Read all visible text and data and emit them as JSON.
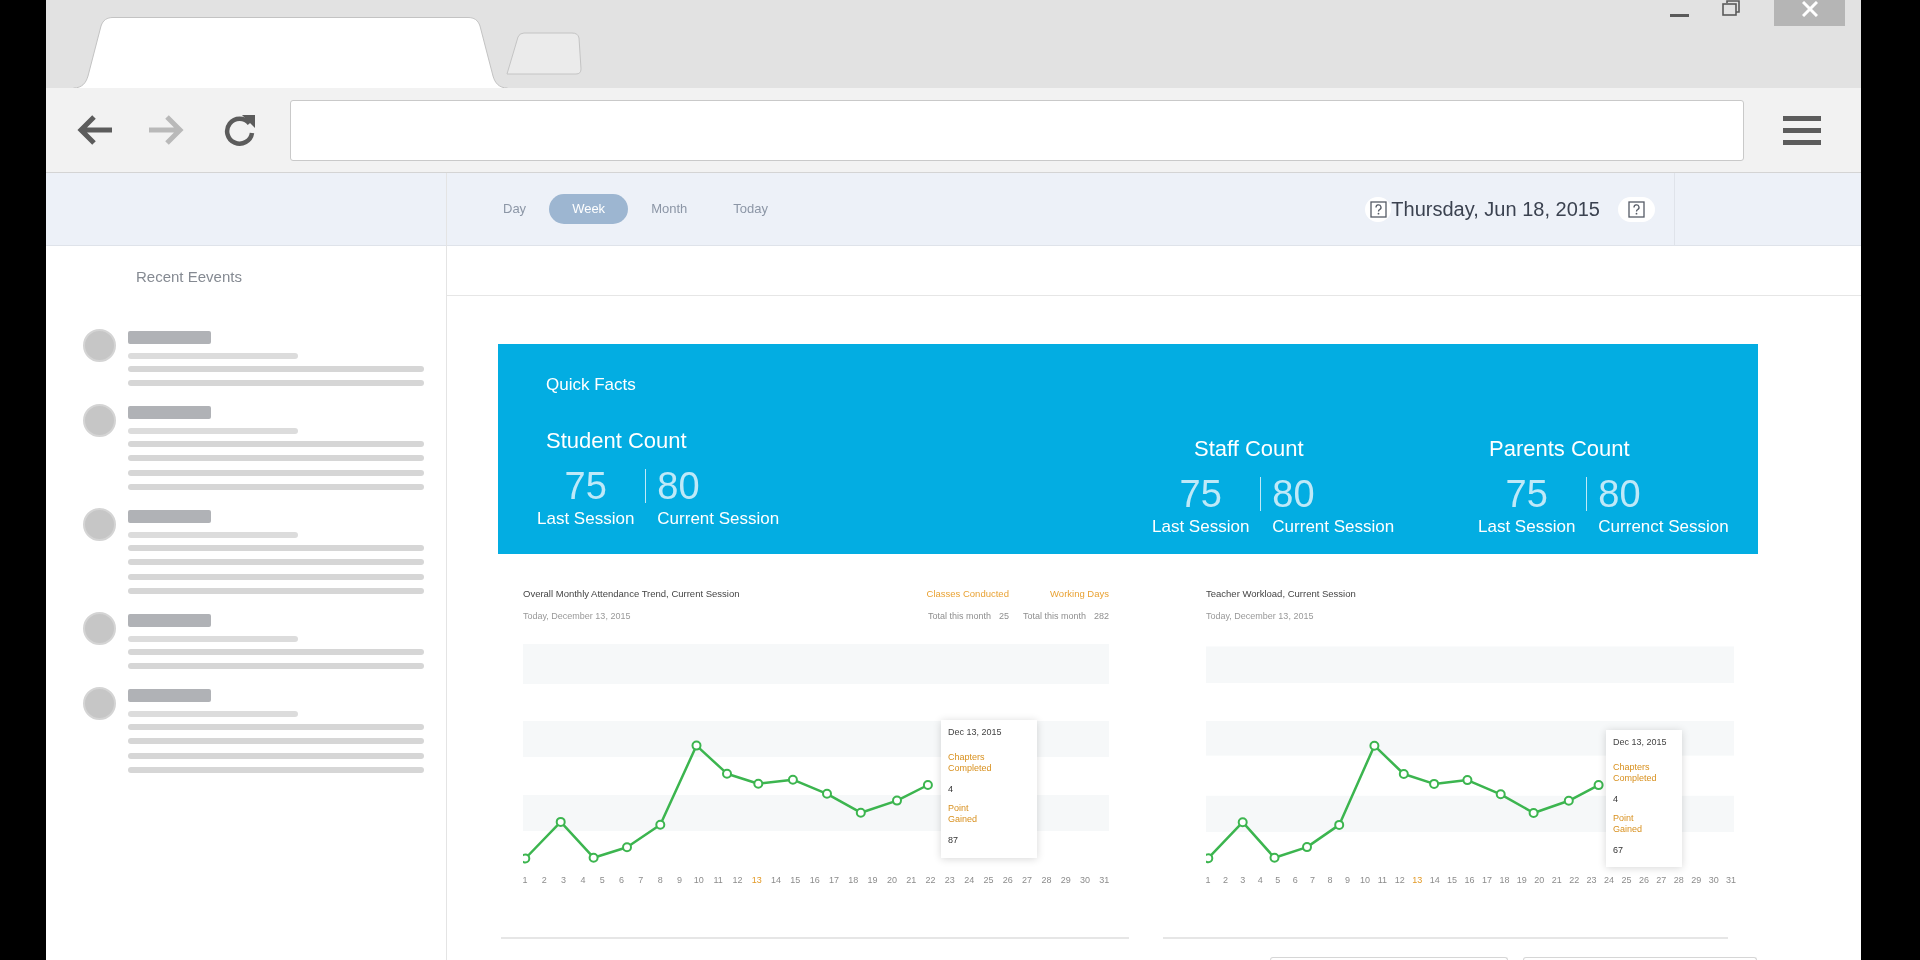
{
  "browser": {
    "buttons": [
      {
        "kind": "back",
        "disabled": false
      },
      {
        "kind": "forward",
        "disabled": true
      },
      {
        "kind": "reload",
        "disabled": false
      }
    ]
  },
  "view_tabs": [
    {
      "label": "Day",
      "selected": false
    },
    {
      "label": "Week",
      "selected": true
    },
    {
      "label": "Month",
      "selected": false
    },
    {
      "label": "Today",
      "selected": false
    }
  ],
  "date_display": "Thursday, Jun 18, 2015",
  "sidebar": {
    "title": "Recent Eevents"
  },
  "quick_facts": {
    "title": "Quick Facts",
    "groups": [
      {
        "title": "Student Count",
        "last_value": "75",
        "current_value": "80",
        "last_label": "Last Session",
        "current_label": "Current Session"
      },
      {
        "title": "Staff Count",
        "last_value": "75",
        "current_value": "80",
        "last_label": "Last Session",
        "current_label": "Current Session"
      },
      {
        "title": "Parents Count",
        "last_value": "75",
        "current_value": "80",
        "last_label": "Last Session",
        "current_label": "Currenct Session"
      }
    ]
  },
  "charts": [
    {
      "title": "Overall Monthly Attendance Trend, Current Session",
      "subtitle": "Today, December 13, 2015",
      "legend": [
        {
          "label": "Classes Conducted",
          "detail": "Total this month",
          "value": "25"
        },
        {
          "label": "Working Days",
          "detail": "Total this month",
          "value": "282"
        }
      ],
      "x_labels": [
        {
          "label": "1",
          "highlighted": false
        },
        {
          "label": "2",
          "highlighted": false
        },
        {
          "label": "3",
          "highlighted": false
        },
        {
          "label": "4",
          "highlighted": false
        },
        {
          "label": "5",
          "highlighted": false
        },
        {
          "label": "6",
          "highlighted": false
        },
        {
          "label": "7",
          "highlighted": false
        },
        {
          "label": "8",
          "highlighted": false
        },
        {
          "label": "9",
          "highlighted": false
        },
        {
          "label": "10",
          "highlighted": false
        },
        {
          "label": "11",
          "highlighted": false
        },
        {
          "label": "12",
          "highlighted": false
        },
        {
          "label": "13",
          "highlighted": true
        },
        {
          "label": "14",
          "highlighted": false
        },
        {
          "label": "15",
          "highlighted": false
        },
        {
          "label": "16",
          "highlighted": false
        },
        {
          "label": "17",
          "highlighted": false
        },
        {
          "label": "18",
          "highlighted": false
        },
        {
          "label": "19",
          "highlighted": false
        },
        {
          "label": "20",
          "highlighted": false
        },
        {
          "label": "21",
          "highlighted": false
        },
        {
          "label": "22",
          "highlighted": false
        },
        {
          "label": "23",
          "highlighted": false
        },
        {
          "label": "24",
          "highlighted": false
        },
        {
          "label": "25",
          "highlighted": false
        },
        {
          "label": "26",
          "highlighted": false
        },
        {
          "label": "27",
          "highlighted": false
        },
        {
          "label": "28",
          "highlighted": false
        },
        {
          "label": "29",
          "highlighted": false
        },
        {
          "label": "30",
          "highlighted": false
        },
        {
          "label": "31",
          "highlighted": false
        }
      ],
      "tooltip": {
        "date": "Dec 13, 2015",
        "rows": [
          {
            "label": "Chapters Completed",
            "value": "4"
          },
          {
            "label": "Point Gained",
            "value": "87"
          }
        ]
      }
    },
    {
      "title": "Teacher Workload, Current Session",
      "subtitle": "Today, December 13, 2015",
      "x_labels": [
        {
          "label": "1",
          "highlighted": false
        },
        {
          "label": "2",
          "highlighted": false
        },
        {
          "label": "3",
          "highlighted": false
        },
        {
          "label": "4",
          "highlighted": false
        },
        {
          "label": "5",
          "highlighted": false
        },
        {
          "label": "6",
          "highlighted": false
        },
        {
          "label": "7",
          "highlighted": false
        },
        {
          "label": "8",
          "highlighted": false
        },
        {
          "label": "9",
          "highlighted": false
        },
        {
          "label": "10",
          "highlighted": false
        },
        {
          "label": "11",
          "highlighted": false
        },
        {
          "label": "12",
          "highlighted": false
        },
        {
          "label": "13",
          "highlighted": true
        },
        {
          "label": "14",
          "highlighted": false
        },
        {
          "label": "15",
          "highlighted": false
        },
        {
          "label": "16",
          "highlighted": false
        },
        {
          "label": "17",
          "highlighted": false
        },
        {
          "label": "18",
          "highlighted": false
        },
        {
          "label": "19",
          "highlighted": false
        },
        {
          "label": "20",
          "highlighted": false
        },
        {
          "label": "21",
          "highlighted": false
        },
        {
          "label": "22",
          "highlighted": false
        },
        {
          "label": "23",
          "highlighted": false
        },
        {
          "label": "24",
          "highlighted": false
        },
        {
          "label": "25",
          "highlighted": false
        },
        {
          "label": "26",
          "highlighted": false
        },
        {
          "label": "27",
          "highlighted": false
        },
        {
          "label": "28",
          "highlighted": false
        },
        {
          "label": "29",
          "highlighted": false
        },
        {
          "label": "30",
          "highlighted": false
        },
        {
          "label": "31",
          "highlighted": false
        }
      ],
      "tooltip": {
        "date": "Dec 13, 2015",
        "rows": [
          {
            "label": "Chapters Completed",
            "value": "4"
          },
          {
            "label": "Point Gained",
            "value": "67"
          }
        ]
      }
    }
  ]
}
